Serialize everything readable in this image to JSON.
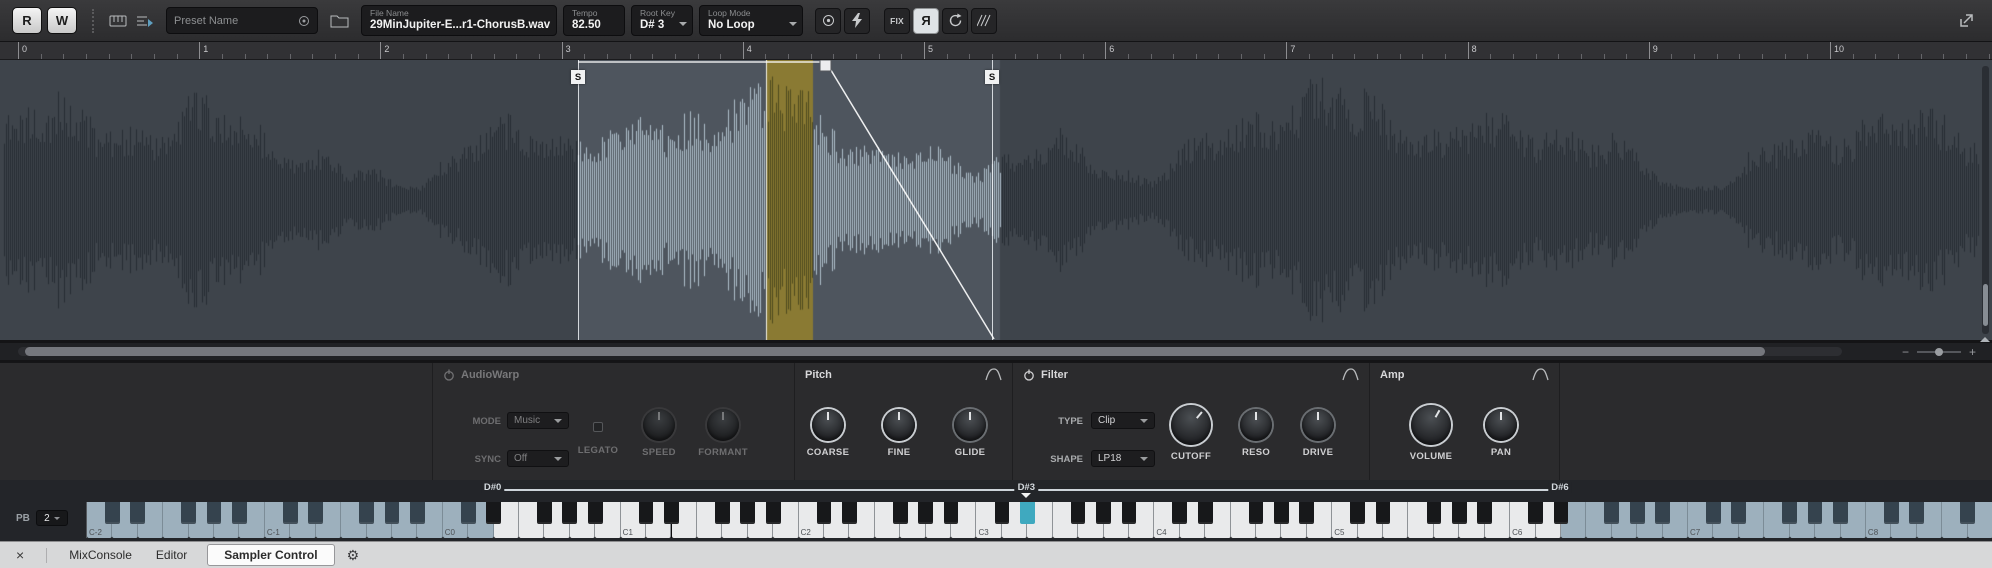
{
  "toolbar": {
    "read": "R",
    "write": "W",
    "preset_placeholder": "Preset Name",
    "file_label": "File Name",
    "file_value": "29MinJupiter-E...r1-ChorusB.wav",
    "tempo_label": "Tempo",
    "tempo_value": "82.50",
    "root_key_label": "Root Key",
    "root_key_value": "D# 3",
    "loop_mode_label": "Loop Mode",
    "loop_mode_value": "No Loop",
    "fix": "FIX",
    "reverse": "Я"
  },
  "ruler": {
    "ticks": [
      "0",
      "1",
      "2",
      "3",
      "4",
      "5",
      "6",
      "7",
      "8",
      "9",
      "10"
    ]
  },
  "waveform": {
    "start_marker": "S",
    "end_marker": "S"
  },
  "audiowarp": {
    "title": "AudioWarp",
    "mode_label": "MODE",
    "mode_value": "Music",
    "sync_label": "SYNC",
    "sync_value": "Off",
    "legato": "LEGATO",
    "speed": "SPEED",
    "formant": "FORMANT",
    "enabled": false
  },
  "pitch": {
    "title": "Pitch",
    "coarse": "COARSE",
    "fine": "FINE",
    "glide": "GLIDE"
  },
  "filter": {
    "title": "Filter",
    "type_label": "TYPE",
    "type_value": "Clip",
    "shape_label": "SHAPE",
    "shape_value": "LP18",
    "cutoff": "CUTOFF",
    "reso": "RESO",
    "drive": "DRIVE",
    "enabled": true
  },
  "amp": {
    "title": "Amp",
    "volume": "VOLUME",
    "pan": "PAN"
  },
  "keyboard": {
    "pb_label": "PB",
    "pb_value": "2",
    "range_low": "D#0",
    "root": "D#3",
    "range_high": "D#6",
    "range_low_midi": 27,
    "root_midi": 63,
    "range_high_midi": 99,
    "octave_labels": [
      "C-2",
      "C-1",
      "C0",
      "C1",
      "C2",
      "C3",
      "C4",
      "C5",
      "C6",
      "C7",
      "C8"
    ]
  },
  "tabs": {
    "mixconsole": "MixConsole",
    "editor": "Editor",
    "sampler": "Sampler Control"
  },
  "colors": {
    "accent_teal": "#3fa9bf",
    "loop_band": "#8a7a33",
    "wave_selected": "#adbdc9",
    "wave_dim": "#262c33"
  }
}
